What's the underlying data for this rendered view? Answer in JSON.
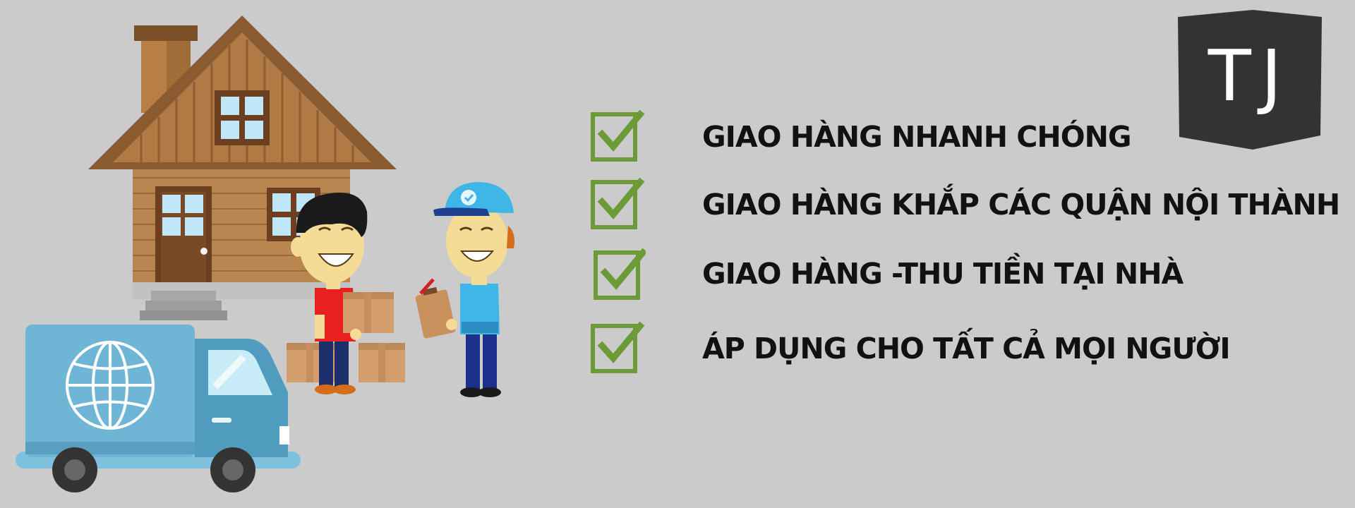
{
  "banner": {
    "features": [
      {
        "text": "GIAO HÀNG NHANH CHÓNG"
      },
      {
        "text": "GIAO HÀNG KHẮP CÁC QUẬN NỘI THÀNH"
      },
      {
        "text": "GIAO HÀNG -THU TIỀN TẠI NHÀ"
      },
      {
        "text": "ÁP DỤNG CHO TẤT CẢ MỌI NGƯỜI"
      }
    ],
    "logo_text": "TJ"
  },
  "colors": {
    "background": "#cbcbcb",
    "check": "#6b9a36",
    "text": "#111111",
    "logo_bg": "#333333",
    "logo_text": "#ffffff",
    "truck_body": "#6fb5d6",
    "house_wood": "#b07a45",
    "courier_shirt": "#3fb6e8",
    "customer_shirt": "#e8201f"
  },
  "icons": [
    "check-icon",
    "house-icon",
    "truck-icon",
    "globe-icon",
    "customer-icon",
    "courier-icon",
    "parcel-icon",
    "clipboard-icon"
  ]
}
